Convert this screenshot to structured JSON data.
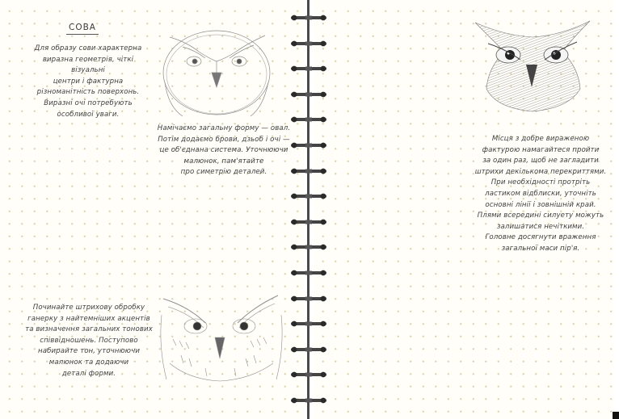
{
  "title": "СОВА",
  "text_intro": [
    "Для образу сови характерна",
    "виразна геометрія, чіткі візуальні",
    "центри і фактурна",
    "різноманітність поверхонь.",
    "Виразні очі потребують",
    "особливої уваги."
  ],
  "text_step1": [
    "Намічаємо загальну форму — овал.",
    "Потім додаємо брови, дзьоб і очі —",
    "це об'єднана система. Уточнюючи",
    "малюнок, пам'ятайте",
    "про симетрію деталей."
  ],
  "text_step2": [
    "Починайте штрихову обробку",
    "ганерку з найтемніших акцентів",
    "та визначення загальних тонових",
    "співвідношень. Поступово",
    "набирайте тон, уточнюючи",
    "малюнок та додаючи",
    "деталі форми."
  ],
  "text_step3": [
    "Місця з добре вираженою",
    "фактурою намагайтеся пройти",
    "за один раз, щоб не загладити",
    "штрихи декількома перекриттями.",
    "При необхідності протріть",
    "ластиком відблиски, уточніть",
    "основні лінії і зовнішній край.",
    "Плями всередині силуету можуть",
    "залишатися нечіткими.",
    "Головне досягнути враження",
    "загальної маси пір'я."
  ],
  "illustrations": [
    "owl-sketch-outline",
    "owl-sketch-shaded",
    "owl-sketch-detailed"
  ]
}
